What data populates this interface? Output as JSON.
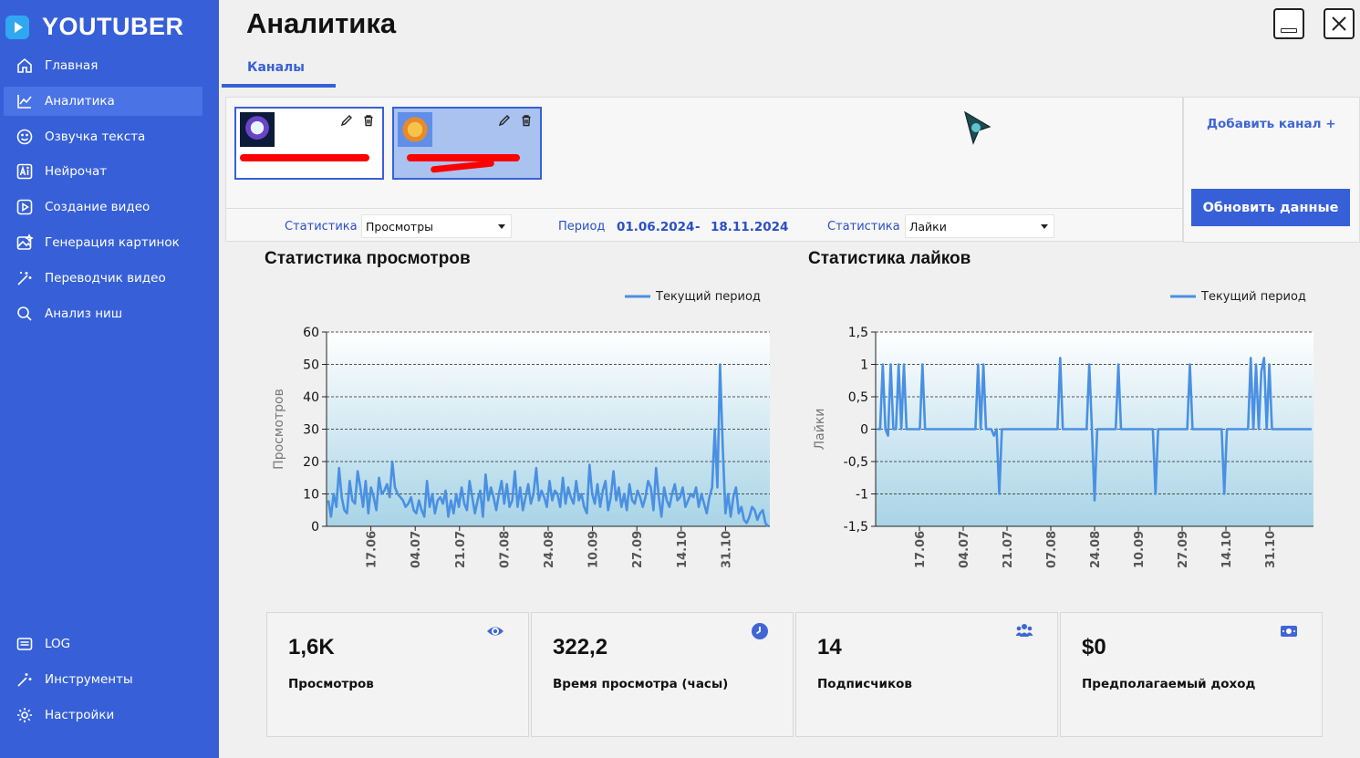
{
  "app": {
    "brand": "YOUTUBER",
    "page_title": "Аналитика"
  },
  "sidebar": {
    "items": [
      {
        "label": "Главная",
        "icon": "home-icon",
        "active": false
      },
      {
        "label": "Аналитика",
        "icon": "chart-icon",
        "active": true
      },
      {
        "label": "Озвучка текста",
        "icon": "smile-icon",
        "active": false
      },
      {
        "label": "Нейрочат",
        "icon": "ai-icon",
        "active": false
      },
      {
        "label": "Создание видео",
        "icon": "video-icon",
        "active": false
      },
      {
        "label": "Генерация картинок",
        "icon": "image-icon",
        "active": false
      },
      {
        "label": "Переводчик видео",
        "icon": "wand-icon",
        "active": false
      },
      {
        "label": "Анализ ниш",
        "icon": "search-icon",
        "active": false
      }
    ],
    "bottom_items": [
      {
        "label": "LOG",
        "icon": "log-icon"
      },
      {
        "label": "Инструменты",
        "icon": "tools-icon"
      },
      {
        "label": "Настройки",
        "icon": "gear-icon"
      }
    ]
  },
  "tabs": {
    "channels": "Каналы"
  },
  "channels": {
    "add_channel": "Добавить канал +",
    "refresh": "Обновить данные"
  },
  "filters": {
    "stat_label_left": "Статистика",
    "stat_value_left": "Просмотры",
    "period_label": "Период",
    "date_from": "01.06.2024",
    "date_sep": "-",
    "date_to": "18.11.2024",
    "stat_label_right": "Статистика",
    "stat_value_right": "Лайки"
  },
  "charts": {
    "views_title": "Статистика просмотров",
    "likes_title": "Статистика лайков"
  },
  "chart_data": [
    {
      "type": "line",
      "title": "Статистика просмотров",
      "ylabel": "Просмотров",
      "ylim": [
        0,
        60
      ],
      "yticks": [
        0,
        10,
        20,
        30,
        40,
        50,
        60
      ],
      "xticks": [
        "17.06",
        "04.07",
        "21.07",
        "07.08",
        "24.08",
        "10.09",
        "27.09",
        "14.10",
        "31.10"
      ],
      "legend": "top-right",
      "series": [
        {
          "name": "Текущий период",
          "color": "#4a90e2",
          "values": [
            8,
            3,
            10,
            6,
            18,
            9,
            5,
            4,
            14,
            8,
            7,
            17,
            12,
            6,
            14,
            4,
            12,
            9,
            5,
            15,
            10,
            11,
            13,
            9,
            20,
            12,
            10,
            9,
            8,
            6,
            7,
            9,
            5,
            4,
            8,
            5,
            3,
            14,
            6,
            10,
            4,
            8,
            9,
            7,
            11,
            3,
            8,
            4,
            10,
            6,
            12,
            7,
            5,
            14,
            9,
            4,
            8,
            11,
            3,
            16,
            8,
            12,
            9,
            5,
            10,
            14,
            7,
            13,
            6,
            8,
            17,
            6,
            12,
            5,
            9,
            13,
            7,
            10,
            18,
            8,
            11,
            9,
            6,
            14,
            8,
            11,
            10,
            6,
            15,
            7,
            12,
            9,
            7,
            14,
            8,
            10,
            6,
            4,
            19,
            10,
            7,
            13,
            6,
            11,
            14,
            5,
            9,
            17,
            8,
            12,
            6,
            10,
            5,
            13,
            8,
            7,
            11,
            9,
            6,
            9,
            14,
            12,
            5,
            18,
            9,
            3,
            12,
            8,
            6,
            10,
            13,
            8,
            9,
            12,
            6,
            8,
            10,
            9,
            12,
            6,
            10,
            7,
            4,
            9,
            12,
            30,
            12,
            50,
            25,
            4,
            10,
            3,
            9,
            12,
            4,
            6,
            2,
            1,
            3,
            6,
            5,
            2,
            4,
            5,
            1,
            0
          ]
        }
      ]
    },
    {
      "type": "line",
      "title": "Статистика лайков",
      "ylabel": "Лайки",
      "ylim": [
        -1.5,
        1.5
      ],
      "yticks": [
        -1.5,
        -1,
        -0.5,
        0,
        0.5,
        1,
        1.5
      ],
      "xticks": [
        "17.06",
        "04.07",
        "21.07",
        "07.08",
        "24.08",
        "10.09",
        "27.09",
        "14.10",
        "31.10"
      ],
      "legend": "top-right",
      "series": [
        {
          "name": "Текущий период",
          "color": "#4a90e2",
          "values": [
            0,
            0,
            1,
            0,
            -0.1,
            1,
            0,
            0,
            1,
            0,
            1,
            0,
            0,
            0,
            0,
            0,
            0,
            1,
            0,
            0,
            0,
            0,
            0,
            0,
            0,
            0,
            0,
            0,
            0,
            0,
            0,
            0,
            0,
            0,
            0,
            0,
            0,
            0,
            1,
            0,
            1,
            0,
            0,
            0,
            -0.1,
            0,
            -1,
            0,
            0,
            0,
            0,
            0,
            0,
            0,
            0,
            0,
            0,
            0,
            0,
            0,
            0,
            0,
            0,
            0,
            0,
            0,
            0,
            0,
            0,
            1.1,
            0,
            0,
            0,
            0,
            0,
            0,
            0,
            0,
            0,
            0,
            1,
            0,
            -1.1,
            0,
            0,
            0,
            0,
            0,
            0,
            0,
            0,
            1,
            0,
            0,
            0,
            0,
            0,
            0,
            0,
            0,
            0,
            0,
            0,
            0,
            0,
            -1,
            0,
            0,
            0,
            0,
            0,
            0,
            0,
            0,
            0,
            0,
            0,
            0,
            1,
            0,
            0,
            0,
            0,
            0,
            0,
            0,
            0,
            0,
            0,
            0,
            0,
            -1,
            0,
            0,
            0,
            0,
            0,
            0,
            0,
            0,
            0,
            1.1,
            0,
            1,
            0,
            0.9,
            1.1,
            0,
            1,
            0,
            0,
            0,
            0,
            0,
            0,
            0,
            0,
            0,
            0,
            0,
            0,
            0,
            0,
            0,
            0
          ]
        }
      ]
    }
  ],
  "stats": [
    {
      "value": "1,6K",
      "label": "Просмотров",
      "icon": "eye-icon"
    },
    {
      "value": "322,2",
      "label": "Время просмотра (часы)",
      "icon": "clock-icon"
    },
    {
      "value": "14",
      "label": "Подписчиков",
      "icon": "users-icon"
    },
    {
      "value": "$0",
      "label": "Предполагаемый доход",
      "icon": "money-icon"
    }
  ]
}
